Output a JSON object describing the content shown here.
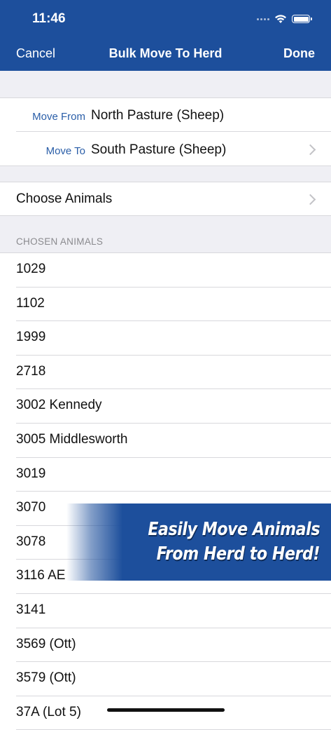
{
  "status_bar": {
    "time": "11:46"
  },
  "nav": {
    "cancel": "Cancel",
    "title": "Bulk Move To Herd",
    "done": "Done"
  },
  "move": {
    "from_label": "Move From",
    "from_value": "North Pasture (Sheep)",
    "to_label": "Move To",
    "to_value": "South Pasture (Sheep)"
  },
  "choose": {
    "label": "Choose Animals"
  },
  "chosen": {
    "header": "CHOSEN ANIMALS",
    "animals": [
      "1029",
      "1102",
      "1999",
      "2718",
      "3002 Kennedy",
      "3005 Middlesworth",
      "3019",
      "3070",
      "3078",
      "3116 AE",
      "3141",
      "3569 (Ott)",
      "3579 (Ott)",
      "37A (Lot 5)"
    ]
  },
  "promo": {
    "line1": "Easily Move Animals",
    "line2": "From Herd to Herd!"
  },
  "colors": {
    "brand": "#1d4f9c",
    "link": "#2a5ea8",
    "group_bg": "#efeff4"
  }
}
